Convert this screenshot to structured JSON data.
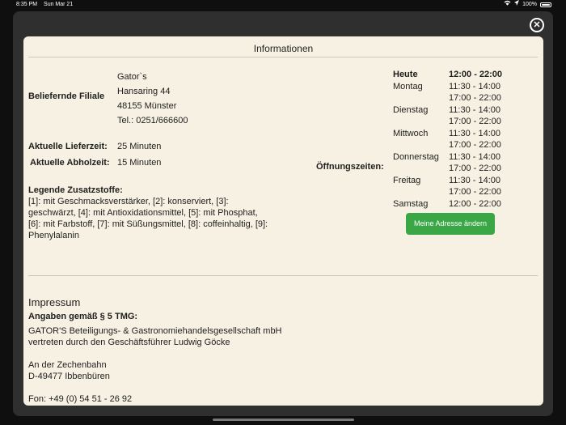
{
  "status_bar": {
    "time": "8:35 PM",
    "date": "Sun Mar 21",
    "battery": "100%"
  },
  "modal": {
    "title": "Informationen",
    "close_icon": "close-circle-icon"
  },
  "store": {
    "label": "Beliefernde Filiale",
    "address": [
      "Gator`s",
      "Hansaring 44",
      "48155 Münster",
      "Tel.: 0251/666600"
    ]
  },
  "delivery": {
    "label": "Aktuelle Lieferzeit:",
    "value": "25 Minuten"
  },
  "pickup": {
    "label": "Aktuelle Abholzeit:",
    "value": "15 Minuten"
  },
  "legend": {
    "title": "Legende Zusatzstoffe:",
    "text": "[1]: mit Geschmacksverstärker, [2]: konserviert, [3]: geschwärzt, [4]: mit Antioxidationsmittel, [5]: mit Phosphat, [6]: mit Farbstoff, [7]: mit Süßungsmittel, [8]: coffeinhaltig, [9]: Phenylalanin"
  },
  "opening_hours": {
    "label": "Öffnungszeiten:",
    "rows": [
      {
        "day": "Heute",
        "time": "12:00 - 22:00"
      },
      {
        "day": "Montag",
        "time": "11:30 - 14:00"
      },
      {
        "day": "",
        "time": "17:00 - 22:00"
      },
      {
        "day": "Dienstag",
        "time": "11:30 - 14:00"
      },
      {
        "day": "",
        "time": "17:00 - 22:00"
      },
      {
        "day": "Mittwoch",
        "time": "11:30 - 14:00"
      },
      {
        "day": "",
        "time": "17:00 - 22:00"
      },
      {
        "day": "Donnerstag",
        "time": "11:30 - 14:00"
      },
      {
        "day": "",
        "time": "17:00 - 22:00"
      },
      {
        "day": "Freitag",
        "time": "11:30 - 14:00"
      },
      {
        "day": "",
        "time": "17:00 - 22:00"
      },
      {
        "day": "Samstag",
        "time": "12:00 - 22:00"
      }
    ]
  },
  "change_address_button": "Meine Adresse ändern",
  "accent_color": "#3aa646",
  "impressum": {
    "title": "Impressum",
    "subtitle": "Angaben gemäß § 5 TMG:",
    "lines": [
      "GATOR'S Beteiligungs- & Gastronomiehandelsgesellschaft mbH",
      "vertreten durch den Geschäftsführer Ludwig Göcke",
      "",
      "An der Zechenbahn",
      "D-49477 Ibbenbüren",
      "",
      "Fon: +49 (0) 54 51 - 26 92"
    ]
  }
}
